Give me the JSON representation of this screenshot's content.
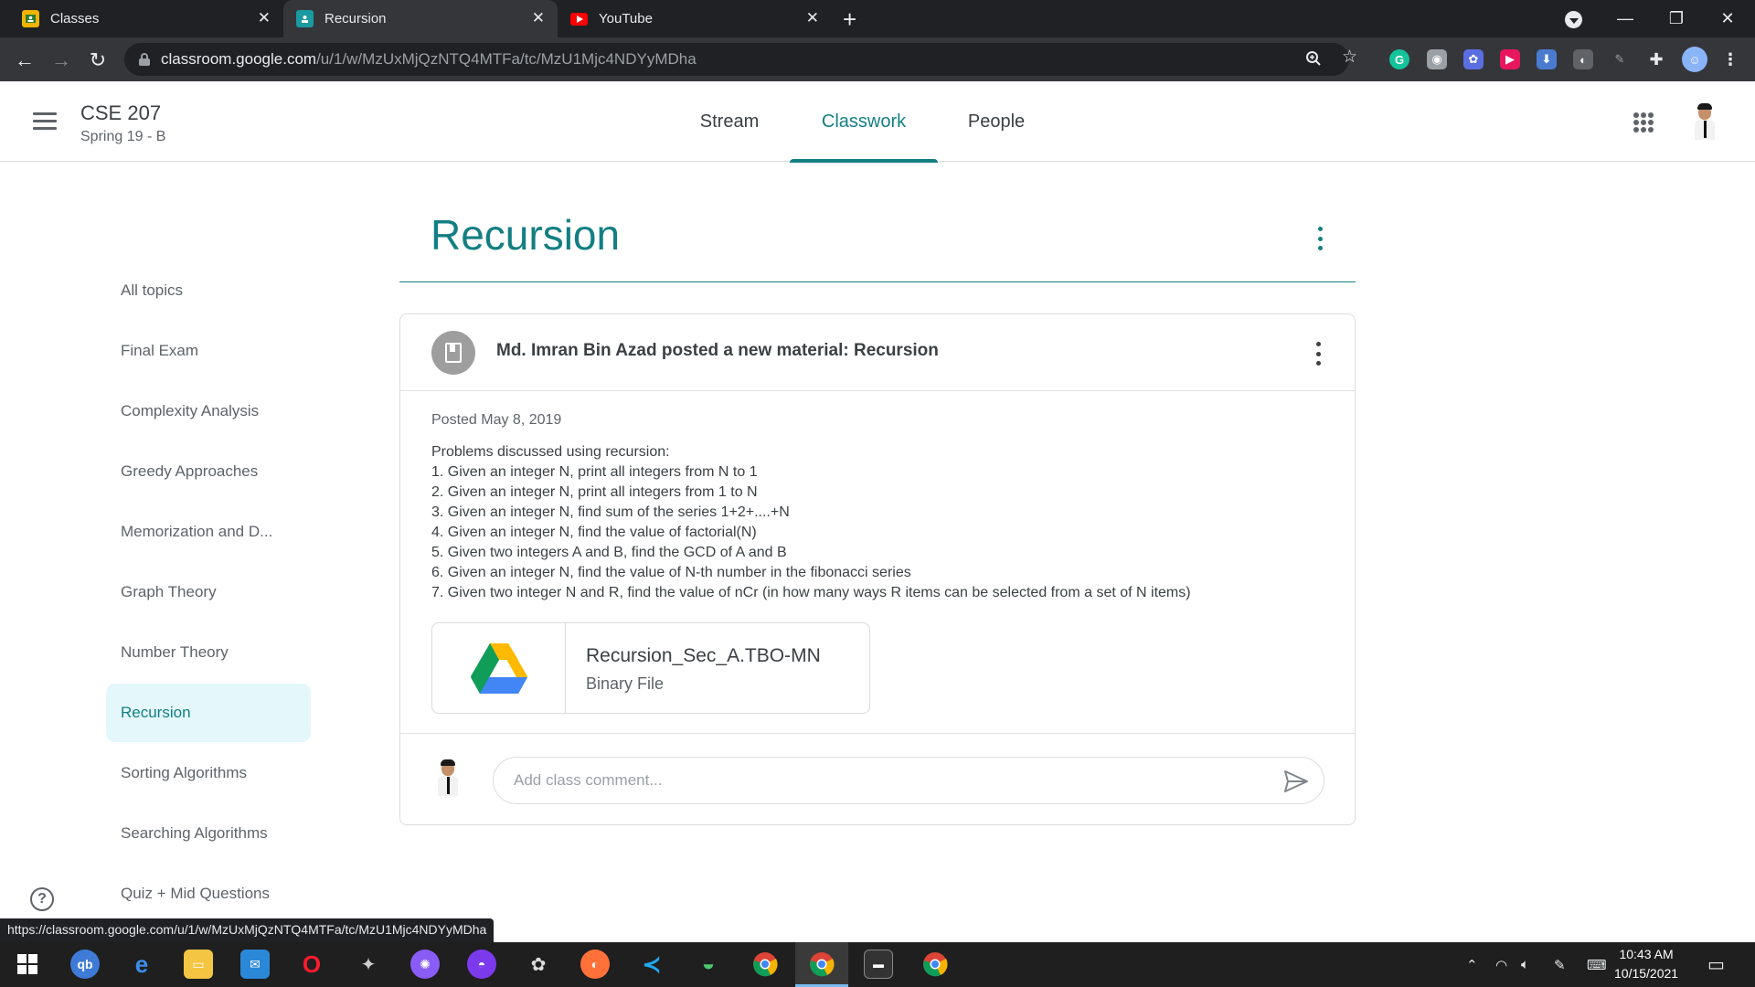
{
  "browser": {
    "tabs": [
      {
        "title": "Classes",
        "icon": "classroom-icon",
        "color": "#f2b400"
      },
      {
        "title": "Recursion",
        "icon": "classroom-icon",
        "color": "#1a9aa1"
      },
      {
        "title": "YouTube",
        "icon": "youtube-icon",
        "color": "#ff0000"
      }
    ],
    "url_host": "classroom.google.com",
    "url_path": "/u/1/w/MzUxMjQzNTQ4MTFa/tc/MzU1Mjc4NDYyMDha",
    "status_url": "https://classroom.google.com/u/1/w/MzUxMjQzNTQ4MTFa/tc/MzU1Mjc4NDYyMDha"
  },
  "header": {
    "class_name": "CSE 207",
    "class_section": "Spring 19 - B",
    "tabs": [
      {
        "label": "Stream",
        "active": false
      },
      {
        "label": "Classwork",
        "active": true
      },
      {
        "label": "People",
        "active": false
      }
    ],
    "accent": "#137f83"
  },
  "sidebar": {
    "topics": [
      {
        "label": "All topics",
        "active": false
      },
      {
        "label": "Final Exam",
        "active": false
      },
      {
        "label": "Complexity Analysis",
        "active": false
      },
      {
        "label": "Greedy Approaches",
        "active": false
      },
      {
        "label": "Memorization and D...",
        "active": false
      },
      {
        "label": "Graph Theory",
        "active": false
      },
      {
        "label": "Number Theory",
        "active": false
      },
      {
        "label": "Recursion",
        "active": true
      },
      {
        "label": "Sorting Algorithms",
        "active": false
      },
      {
        "label": "Searching Algorithms",
        "active": false
      },
      {
        "label": "Quiz + Mid Questions",
        "active": false
      }
    ]
  },
  "main": {
    "heading": "Recursion",
    "post": {
      "title": "Md. Imran Bin Azad posted a new material: Recursion",
      "posted": "Posted May 8, 2019",
      "description": [
        "Problems discussed using recursion:",
        "1. Given an integer N, print all integers from N to 1",
        "2. Given an integer N, print all integers from 1 to N",
        "3. Given an integer N, find sum of the series 1+2+....+N",
        "4. Given an integer N, find the value of factorial(N)",
        "5. Given two integers A and B, find the GCD of A and B",
        "6. Given an integer N, find the value of N-th number in the fibonacci series",
        "7. Given two integer N and R, find the value of nCr (in how many ways R items can be selected from a set of N items)"
      ],
      "attachment": {
        "name": "Recursion_Sec_A.TBO-MN",
        "type": "Binary File",
        "icon": "google-drive-icon"
      },
      "comment_placeholder": "Add class comment..."
    }
  },
  "taskbar": {
    "time": "10:43 AM",
    "date": "10/15/2021"
  }
}
